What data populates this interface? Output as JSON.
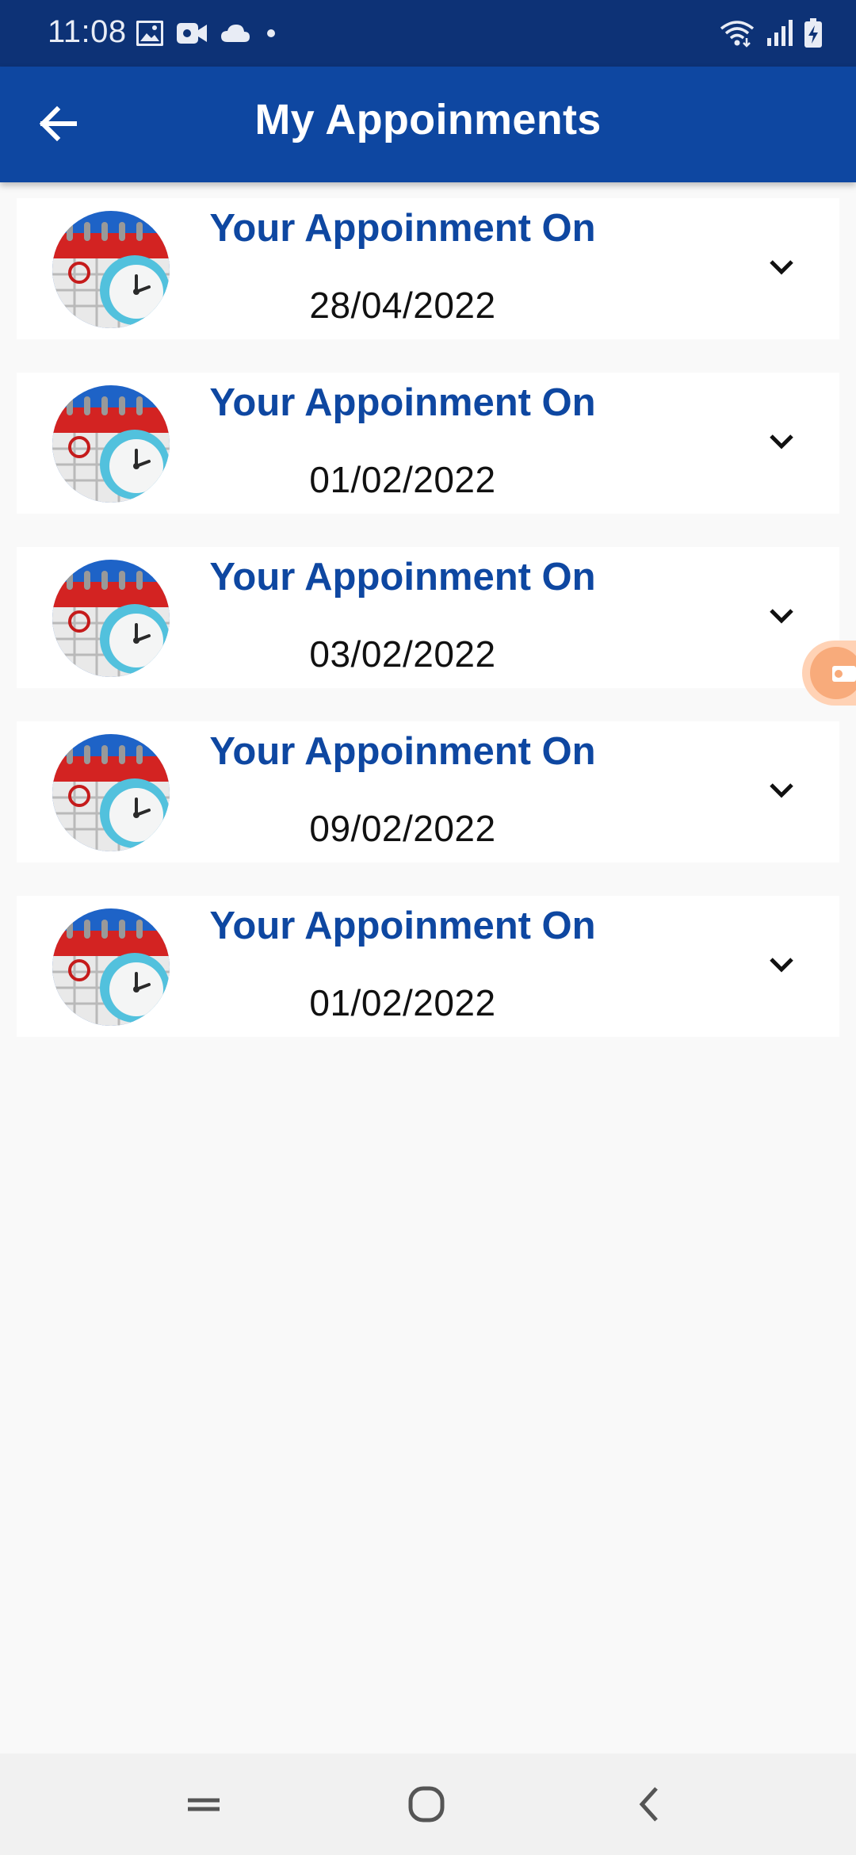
{
  "status_bar": {
    "time": "11:08",
    "left_icons": [
      "image-icon",
      "video-camera-icon",
      "cloud-icon",
      "dot-icon"
    ],
    "right_icons": [
      "wifi-icon",
      "signal-icon",
      "battery-charging-icon"
    ]
  },
  "app_bar": {
    "title": "My Appoinments",
    "back_icon": "arrow-left-icon",
    "background": "#0e47a1"
  },
  "appointments": [
    {
      "heading": "Your Appoinment On",
      "date": "28/04/2022"
    },
    {
      "heading": "Your Appoinment On",
      "date": "01/02/2022"
    },
    {
      "heading": "Your Appoinment On",
      "date": "03/02/2022"
    },
    {
      "heading": "Your Appoinment On",
      "date": "09/02/2022"
    },
    {
      "heading": "Your Appoinment On",
      "date": "01/02/2022"
    }
  ],
  "colors": {
    "accent": "#0e47a1",
    "status_bar": "#0d3276",
    "floating_button": "#f8ab7b"
  },
  "nav_bar": {
    "buttons": [
      "recent-apps-icon",
      "home-icon",
      "back-icon"
    ]
  }
}
